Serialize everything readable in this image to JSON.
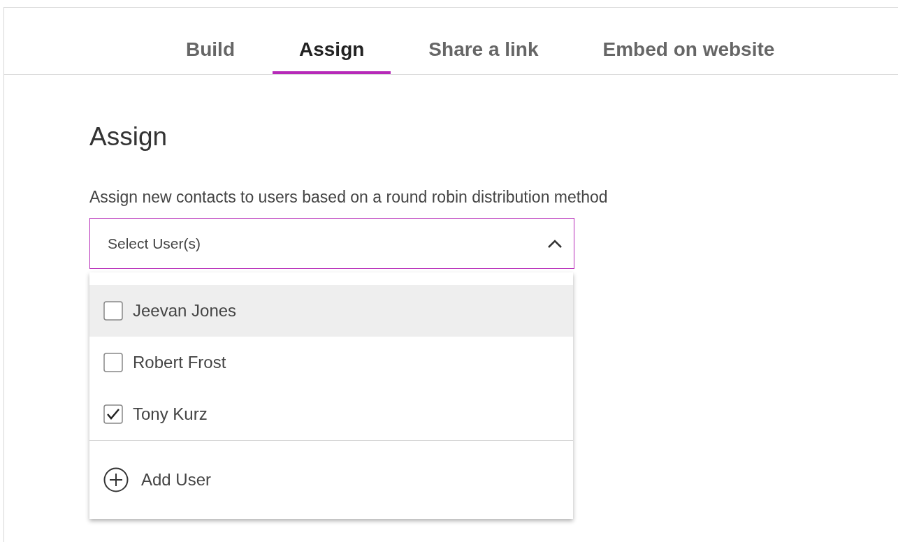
{
  "tabs": [
    {
      "label": "Build",
      "selected": false
    },
    {
      "label": "Assign",
      "selected": true
    },
    {
      "label": "Share a link",
      "selected": false
    },
    {
      "label": "Embed on website",
      "selected": false
    }
  ],
  "heading": "Assign",
  "description": "Assign new contacts to users based on a round robin distribution method",
  "select": {
    "placeholder": "Select User(s)",
    "expanded": true
  },
  "users": [
    {
      "name": "Jeevan Jones",
      "checked": false,
      "highlighted": true
    },
    {
      "name": "Robert Frost",
      "checked": false,
      "highlighted": false
    },
    {
      "name": "Tony Kurz",
      "checked": true,
      "highlighted": false
    }
  ],
  "add_user": "Add User"
}
